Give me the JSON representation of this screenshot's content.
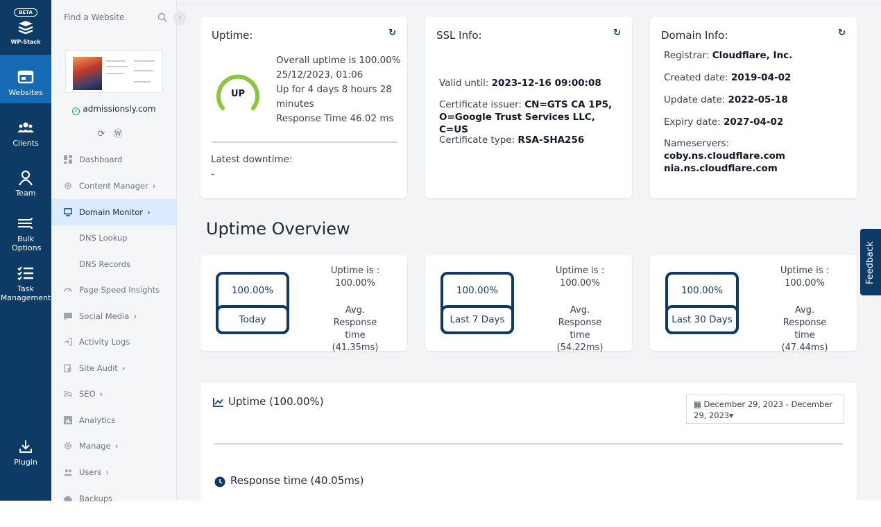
{
  "rail": {
    "beta": "BETA",
    "brand": "WP-Stack",
    "items": [
      {
        "label": "Websites",
        "icon": "websites-icon"
      },
      {
        "label": "Clients",
        "icon": "clients-icon"
      },
      {
        "label": "Team",
        "icon": "team-icon"
      },
      {
        "label": "Bulk Options",
        "icon": "bulk-icon"
      },
      {
        "label": "Task Management",
        "icon": "task-icon"
      },
      {
        "label": "Plugin",
        "icon": "plugin-icon"
      }
    ]
  },
  "sidebar": {
    "search_placeholder": "Find a Website",
    "site_name": "admissionsly.com",
    "nav": [
      {
        "label": "Dashboard"
      },
      {
        "label": "Content Manager"
      },
      {
        "label": "Domain Monitor"
      },
      {
        "label": "DNS Lookup"
      },
      {
        "label": "DNS Records"
      },
      {
        "label": "Page Speed Insights"
      },
      {
        "label": "Social Media"
      },
      {
        "label": "Activity Logs"
      },
      {
        "label": "Site Audit"
      },
      {
        "label": "SEO"
      },
      {
        "label": "Analytics"
      },
      {
        "label": "Manage"
      },
      {
        "label": "Users"
      },
      {
        "label": "Backups"
      }
    ]
  },
  "uptime_card": {
    "title": "Uptime:",
    "status": "UP",
    "overall": "Overall uptime is 100.00%",
    "since": "25/12/2023, 01:06",
    "up_for": "Up for 4 days 8 hours 28 minutes",
    "response": "Response Time 46.02 ms",
    "latest_downtime_label": "Latest downtime:",
    "latest_downtime_value": "-"
  },
  "ssl_card": {
    "title": "SSL Info:",
    "valid_label": "Valid until: ",
    "valid_value": "2023-12-16 09:00:08",
    "issuer_label": "Certificate issuer: ",
    "issuer_value": "CN=GTS CA 1P5, O=Google Trust Services LLC, C=US",
    "type_label": "Certificate type: ",
    "type_value": "RSA-SHA256"
  },
  "domain_card": {
    "title": "Domain Info:",
    "registrar_label": "Registrar: ",
    "registrar_value": "Cloudflare, Inc.",
    "created_label": "Created date: ",
    "created_value": "2019-04-02",
    "updated_label": "Update date: ",
    "updated_value": "2022-05-18",
    "expiry_label": "Expiry date: ",
    "expiry_value": "2027-04-02",
    "ns_label": "Nameservers:",
    "ns1": "coby.ns.cloudflare.com",
    "ns2": "nia.ns.cloudflare.com"
  },
  "overview": {
    "title": "Uptime Overview",
    "periods": [
      {
        "pct": "100.00%",
        "label": "Today",
        "uptime_label": "Uptime is :",
        "uptime_value": "100.00%",
        "avg_label": "Avg. Response time",
        "avg_value": "(41.35ms)"
      },
      {
        "pct": "100.00%",
        "label": "Last 7 Days",
        "uptime_label": "Uptime is :",
        "uptime_value": "100.00%",
        "avg_label": "Avg. Response time",
        "avg_value": "(54.22ms)"
      },
      {
        "pct": "100.00%",
        "label": "Last 30 Days",
        "uptime_label": "Uptime is :",
        "uptime_value": "100.00%",
        "avg_label": "Avg. Response time",
        "avg_value": "(47.44ms)"
      }
    ]
  },
  "history": {
    "uptime_title": "Uptime (100.00%)",
    "date_range": "December 29, 2023 - December 29, 2023",
    "response_title": "Response time (40.05ms)"
  },
  "feedback": "Feedback",
  "colors": {
    "navy": "#0d3b66",
    "active_rail": "#1669b3",
    "gauge": "#8cc63f"
  }
}
